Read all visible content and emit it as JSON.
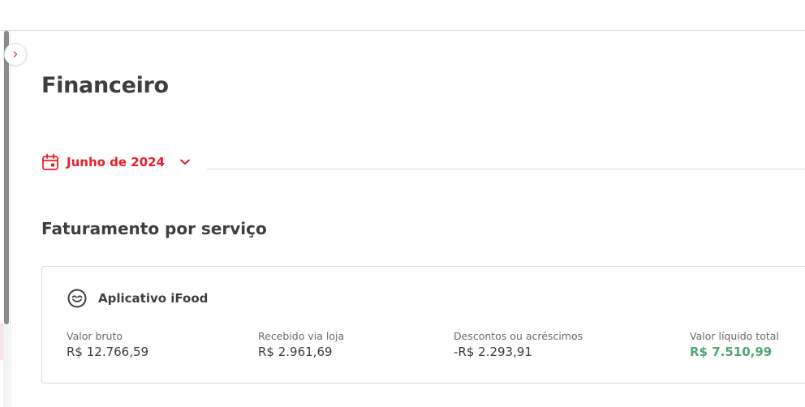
{
  "page": {
    "title": "Financeiro"
  },
  "period": {
    "label": "Junho de 2024"
  },
  "section": {
    "title": "Faturamento por serviço"
  },
  "service_card": {
    "title": "Aplicativo iFood",
    "metrics": [
      {
        "label": "Valor bruto",
        "value": "R$ 12.766,59"
      },
      {
        "label": "Recebido via loja",
        "value": "R$ 2.961,69"
      },
      {
        "label": "Descontos ou acréscimos",
        "value": "-R$ 2.293,91"
      },
      {
        "label": "Valor líquido total",
        "value": "R$ 7.510,99"
      }
    ]
  },
  "icons": {
    "collapse": "chevron-right-icon",
    "period": "calendar-icon",
    "period_toggle": "chevron-down-icon",
    "service": "ifood-logo-icon"
  },
  "colors": {
    "accent": "#ea1d2c",
    "positive": "#50a773",
    "text": "#3e3e3e",
    "muted": "#6b6b6b",
    "border": "#dcdcdc"
  }
}
